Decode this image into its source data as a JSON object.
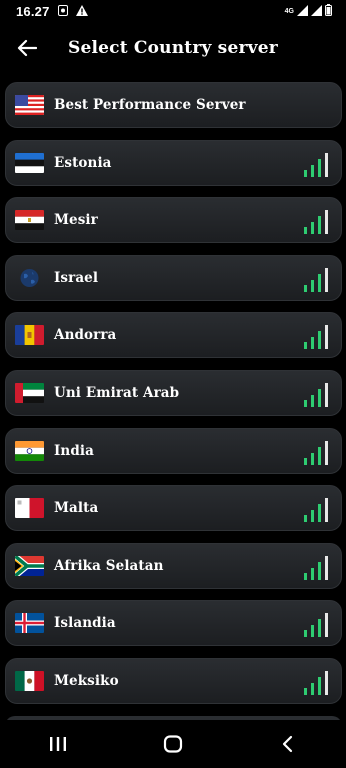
{
  "status_bar": {
    "time": "16.27",
    "net": "4G"
  },
  "header": {
    "title": "Select Country server",
    "back_icon": "arrow-left-icon"
  },
  "servers": [
    {
      "name": "Best Performance Server",
      "flag": "united-states-flag",
      "signal": false
    },
    {
      "name": "Estonia",
      "flag": "estonia-flag",
      "signal": true
    },
    {
      "name": "Mesir",
      "flag": "egypt-flag",
      "signal": true
    },
    {
      "name": "Israel",
      "flag": "globe-icon",
      "signal": true
    },
    {
      "name": "Andorra",
      "flag": "andorra-flag",
      "signal": true
    },
    {
      "name": "Uni Emirat Arab",
      "flag": "uae-flag",
      "signal": true
    },
    {
      "name": "India",
      "flag": "india-flag",
      "signal": true
    },
    {
      "name": "Malta",
      "flag": "malta-flag",
      "signal": true
    },
    {
      "name": "Afrika Selatan",
      "flag": "south-africa-flag",
      "signal": true
    },
    {
      "name": "Islandia",
      "flag": "iceland-flag",
      "signal": true
    },
    {
      "name": "Meksiko",
      "flag": "mexico-flag",
      "signal": true
    }
  ],
  "colors": {
    "signal_active": "#2ecc71",
    "signal_top": "#e8e8e8",
    "card_bg": "#23262a"
  }
}
